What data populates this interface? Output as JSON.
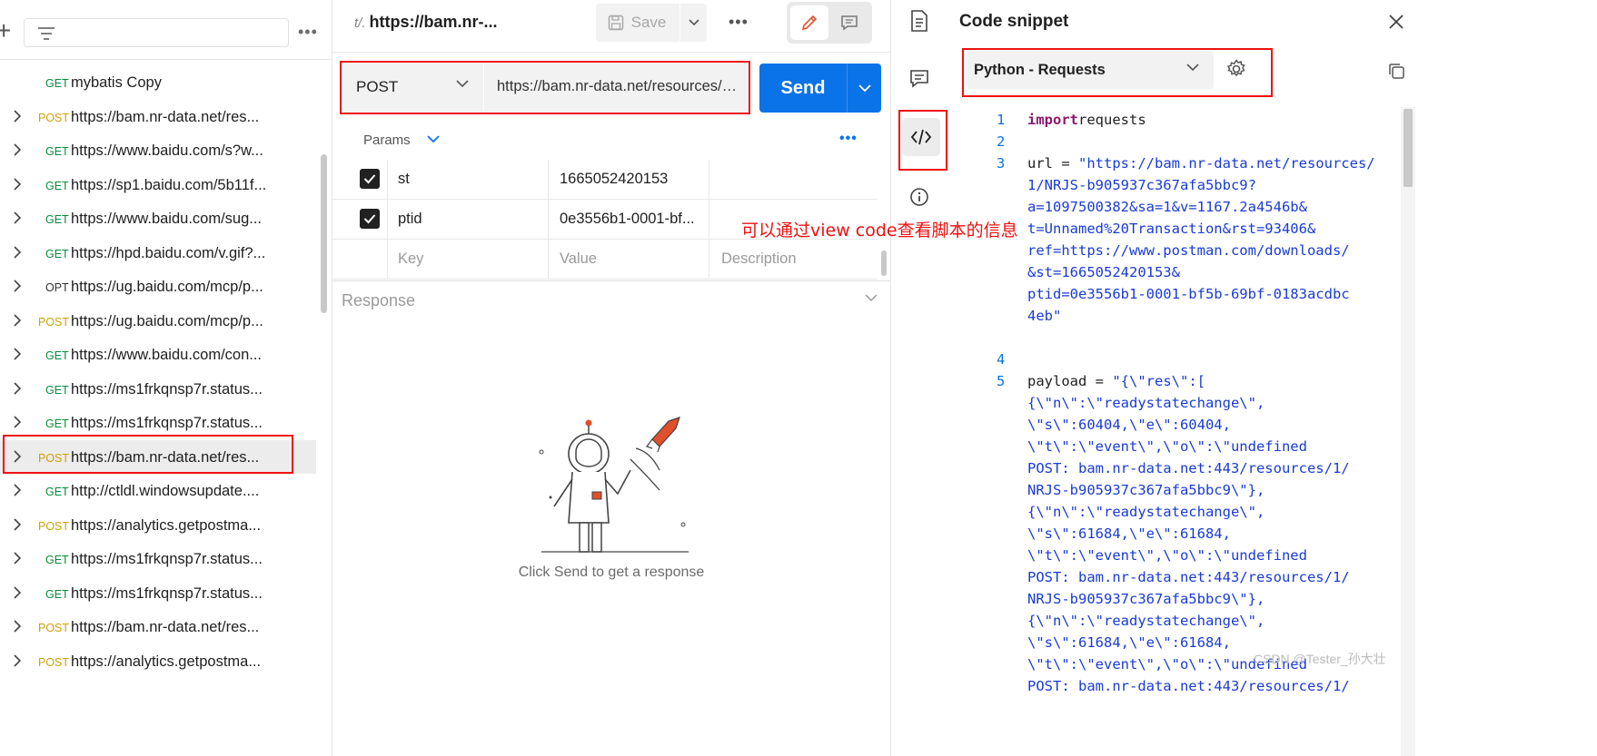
{
  "sidebar": {
    "items": [
      {
        "method": "GET",
        "name": "mybatis Copy",
        "chevron": false
      },
      {
        "method": "POST",
        "name": "https://bam.nr-data.net/res...",
        "chevron": true
      },
      {
        "method": "GET",
        "name": "https://www.baidu.com/s?w...",
        "chevron": true
      },
      {
        "method": "GET",
        "name": "https://sp1.baidu.com/5b11f...",
        "chevron": true
      },
      {
        "method": "GET",
        "name": "https://www.baidu.com/sug...",
        "chevron": true
      },
      {
        "method": "GET",
        "name": "https://hpd.baidu.com/v.gif?...",
        "chevron": true
      },
      {
        "method": "OPT",
        "name": "https://ug.baidu.com/mcp/p...",
        "chevron": true
      },
      {
        "method": "POST",
        "name": "https://ug.baidu.com/mcp/p...",
        "chevron": true
      },
      {
        "method": "GET",
        "name": "https://www.baidu.com/con...",
        "chevron": true
      },
      {
        "method": "GET",
        "name": "https://ms1frkqnsp7r.status...",
        "chevron": true
      },
      {
        "method": "GET",
        "name": "https://ms1frkqnsp7r.status...",
        "chevron": true
      },
      {
        "method": "POST",
        "name": "https://bam.nr-data.net/res...",
        "chevron": true,
        "selected": true
      },
      {
        "method": "GET",
        "name": "http://ctldl.windowsupdate....",
        "chevron": true
      },
      {
        "method": "POST",
        "name": "https://analytics.getpostma...",
        "chevron": true
      },
      {
        "method": "GET",
        "name": "https://ms1frkqnsp7r.status...",
        "chevron": true
      },
      {
        "method": "GET",
        "name": "https://ms1frkqnsp7r.status...",
        "chevron": true
      },
      {
        "method": "POST",
        "name": "https://bam.nr-data.net/res...",
        "chevron": true
      },
      {
        "method": "POST",
        "name": "https://analytics.getpostma...",
        "chevron": true
      }
    ]
  },
  "tab": {
    "title": "https://bam.nr-...",
    "icon_text": "t/."
  },
  "toolbar": {
    "save_label": "Save"
  },
  "request": {
    "method": "POST",
    "url": "https://bam.nr-data.net/resources/1/NRJS-b905937c367afa5bbc9?a=1097500382&sa=1&v=1167.2a4546b&t=Unnamed%20Transaction&rst=93406&ref=https://www.postman.com/downloads/&st=1665052420153&ptid=0e3556b1-0001-bf5b-69bf-0183acdbc4eb",
    "send_label": "Send"
  },
  "params": {
    "tab_label": "Params",
    "rows": [
      {
        "key": "st",
        "value": "1665052420153",
        "checked": true
      },
      {
        "key": "ptid",
        "value": "0e3556b1-0001-bf...",
        "checked": true
      }
    ],
    "placeholder": {
      "key": "Key",
      "value": "Value",
      "description": "Description"
    }
  },
  "response": {
    "label": "Response",
    "empty_message": "Click Send to get a response"
  },
  "code_snippet": {
    "title": "Code snippet",
    "language": "Python - Requests",
    "lines": [
      {
        "n": "1",
        "segments": [
          [
            "kw",
            "import"
          ],
          [
            "",
            "requests"
          ]
        ]
      },
      {
        "n": "2",
        "segments": []
      },
      {
        "n": "3",
        "segments": [
          [
            "",
            "url = "
          ],
          [
            "str",
            "\"https://bam.nr-data.net/resources/"
          ]
        ]
      },
      {
        "n": "",
        "segments": [
          [
            "str",
            "1/NRJS-b905937c367afa5bbc9?"
          ]
        ]
      },
      {
        "n": "",
        "segments": [
          [
            "str",
            "a=1097500382&sa=1&v=1167.2a4546b&"
          ]
        ]
      },
      {
        "n": "",
        "segments": [
          [
            "str",
            "t=Unnamed%20Transaction&rst=93406&"
          ]
        ]
      },
      {
        "n": "",
        "segments": [
          [
            "str",
            "ref=https://www.postman.com/downloads/"
          ]
        ]
      },
      {
        "n": "",
        "segments": [
          [
            "str",
            "&st=1665052420153&"
          ]
        ]
      },
      {
        "n": "",
        "segments": [
          [
            "str",
            "ptid=0e3556b1-0001-bf5b-69bf-0183acdbc"
          ]
        ]
      },
      {
        "n": "",
        "segments": [
          [
            "str",
            "4eb\""
          ]
        ]
      },
      {
        "n": "",
        "segments": []
      },
      {
        "n": "4",
        "segments": []
      },
      {
        "n": "5",
        "segments": [
          [
            "",
            "payload = "
          ],
          [
            "str",
            "\"{\\\"res\\\":["
          ]
        ]
      },
      {
        "n": "",
        "segments": [
          [
            "str",
            "{\\\"n\\\":\\\"readystatechange\\\","
          ]
        ]
      },
      {
        "n": "",
        "segments": [
          [
            "str",
            "\\\"s\\\":60404,\\\"e\\\":60404,"
          ]
        ]
      },
      {
        "n": "",
        "segments": [
          [
            "str",
            "\\\"t\\\":\\\"event\\\",\\\"o\\\":\\\"undefined"
          ]
        ]
      },
      {
        "n": "",
        "segments": [
          [
            "str",
            "POST: bam.nr-data.net:443/resources/1/"
          ]
        ]
      },
      {
        "n": "",
        "segments": [
          [
            "str",
            "NRJS-b905937c367afa5bbc9\\\"},"
          ]
        ]
      },
      {
        "n": "",
        "segments": [
          [
            "str",
            "{\\\"n\\\":\\\"readystatechange\\\","
          ]
        ]
      },
      {
        "n": "",
        "segments": [
          [
            "str",
            "\\\"s\\\":61684,\\\"e\\\":61684,"
          ]
        ]
      },
      {
        "n": "",
        "segments": [
          [
            "str",
            "\\\"t\\\":\\\"event\\\",\\\"o\\\":\\\"undefined"
          ]
        ]
      },
      {
        "n": "",
        "segments": [
          [
            "str",
            "POST: bam.nr-data.net:443/resources/1/"
          ]
        ]
      },
      {
        "n": "",
        "segments": [
          [
            "str",
            "NRJS-b905937c367afa5bbc9\\\"},"
          ]
        ]
      },
      {
        "n": "",
        "segments": [
          [
            "str",
            "{\\\"n\\\":\\\"readystatechange\\\","
          ]
        ]
      },
      {
        "n": "",
        "segments": [
          [
            "str",
            "\\\"s\\\":61684,\\\"e\\\":61684,"
          ]
        ]
      },
      {
        "n": "",
        "segments": [
          [
            "str",
            "\\\"t\\\":\\\"event\\\",\\\"o\\\":\\\"undefined"
          ]
        ]
      },
      {
        "n": "",
        "segments": [
          [
            "str",
            "POST: bam.nr-data.net:443/resources/1/"
          ]
        ]
      }
    ]
  },
  "annotation": "可以通过view code查看脚本的信息",
  "watermark": "CSDN @Tester_孙大壮",
  "colors": {
    "accent": "#0b73e8",
    "get": "#0b8a3d",
    "post": "#d4a106",
    "highlight": "#ee1111"
  }
}
